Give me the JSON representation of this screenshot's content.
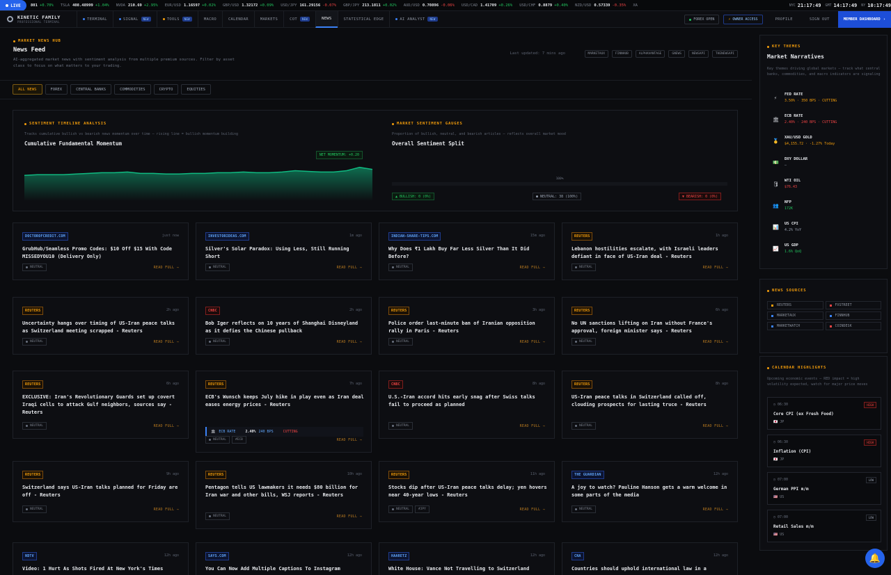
{
  "ticker": {
    "live_label": "LIVE",
    "items": [
      {
        "sym": "",
        "price": "801",
        "chg": "+0.70%",
        "dir": "up"
      },
      {
        "sym": "TSLA",
        "price": "408.48999",
        "chg": "+1.04%",
        "dir": "up"
      },
      {
        "sym": "NVDA",
        "price": "210.69",
        "chg": "+2.95%",
        "dir": "up"
      },
      {
        "sym": "EUR/USD",
        "price": "1.16597",
        "chg": "+0.02%",
        "dir": "up"
      },
      {
        "sym": "GBP/USD",
        "price": "1.32172",
        "chg": "+0.09%",
        "dir": "up"
      },
      {
        "sym": "USD/JPY",
        "price": "161.29156",
        "chg": "-0.07%",
        "dir": "dn"
      },
      {
        "sym": "GBP/JPY",
        "price": "213.1811",
        "chg": "+0.02%",
        "dir": "up"
      },
      {
        "sym": "AUD/USD",
        "price": "0.70896",
        "chg": "-0.06%",
        "dir": "dn"
      },
      {
        "sym": "USD/CAD",
        "price": "1.41709",
        "chg": "+0.26%",
        "dir": "up"
      },
      {
        "sym": "USD/CHF",
        "price": "0.8879",
        "chg": "+0.40%",
        "dir": "up"
      },
      {
        "sym": "NZD/USD",
        "price": "0.57339",
        "chg": "-0.35%",
        "dir": "dn"
      },
      {
        "sym": "XA",
        "price": "",
        "chg": "",
        "dir": "up"
      }
    ],
    "clocks": [
      {
        "city": "NYC",
        "time": "21:17:49"
      },
      {
        "city": "GMT",
        "time": "14:17:49"
      },
      {
        "city": "NY",
        "time": "10:17:49"
      }
    ]
  },
  "nav": {
    "brand_title": "KINETIC FAMILY",
    "brand_sub": "PROFESSIONAL TERMINAL",
    "items": [
      {
        "label": "TERMINAL",
        "dot": "#3b82f6",
        "badge": ""
      },
      {
        "label": "SIGNAL",
        "dot": "#3b82f6",
        "badge": "NEW"
      },
      {
        "label": "TOOLS",
        "dot": "#f59e0b",
        "badge": "NEW"
      },
      {
        "label": "MACRO",
        "dot": "",
        "badge": ""
      },
      {
        "label": "CALENDAR",
        "dot": "",
        "badge": ""
      },
      {
        "label": "MARKETS",
        "dot": "",
        "badge": ""
      },
      {
        "label": "COT",
        "dot": "",
        "badge": "NEW"
      },
      {
        "label": "NEWS",
        "dot": "",
        "badge": ""
      },
      {
        "label": "STATISTICAL EDGE",
        "dot": "",
        "badge": ""
      },
      {
        "label": "AI ANALYST",
        "dot": "#3b82f6",
        "badge": "NEW"
      }
    ],
    "forex_open": "FOREX OPEN",
    "owner_access": "OWNER ACCESS",
    "profile": "PROFILE",
    "sign_out": "SIGN OUT",
    "member": "MEMBER DASHBOARD"
  },
  "hero": {
    "eyebrow": "MARKET NEWS HUB",
    "title": "News Feed",
    "subtitle": "AI-aggregated market news with sentiment analysis from multiple premium sources. Filter by asset class to focus on what matters to your trading.",
    "updated": "Last updated: 7 mins ago",
    "sources": [
      "MARKETAUX",
      "FINNHUB",
      "ALPHAVANTAGE",
      "GNEWS",
      "NEWSAPI",
      "THENEWSAPI"
    ]
  },
  "filters": [
    "ALL NEWS",
    "FOREX",
    "CENTRAL BANKS",
    "COMMODITIES",
    "CRYPTO",
    "EQUITIES"
  ],
  "timeline": {
    "eyebrow": "SENTIMENT TIMELINE ANALYSIS",
    "subtitle": "Tracks cumulative bullish vs bearish news momentum over time — rising line = bullish momentum building",
    "title": "Cumulative Fundamental Momentum",
    "net_momentum": "NET MOMENTUM: +0.20"
  },
  "gauges": {
    "eyebrow": "MARKET SENTIMENT GAUGES",
    "subtitle": "Proportion of bullish, neutral, and bearish articles — reflects overall market mood",
    "title": "Overall Sentiment Split",
    "pct_label": "100%",
    "bullish": "▲ BULLISH: 0 (0%)",
    "neutral": "● NEUTRAL: 38 (100%)",
    "bearish": "▼ BEARISH: 0 (0%)"
  },
  "chart_data": {
    "type": "area",
    "title": "Cumulative Fundamental Momentum",
    "y": [
      0.08,
      0.09,
      0.09,
      0.09,
      0.1,
      0.11,
      0.12,
      0.12,
      0.13,
      0.11,
      0.11,
      0.1,
      0.1,
      0.11,
      0.11,
      0.12,
      0.12,
      0.13,
      0.12,
      0.12,
      0.13,
      0.15,
      0.14,
      0.13,
      0.13,
      0.15,
      0.2,
      0.17
    ],
    "ylim": [
      -0.3,
      0.3
    ],
    "grid": false
  },
  "cards": [
    {
      "src": "DOCTOROFCREDIT.COM",
      "kind": "blue",
      "ago": "just now",
      "title": "GrubHub/Seamless Promo Codes: $10 Off $15 With Code MISSEDYOU10 (Delivery Only)",
      "tags": [
        "NEUTRAL"
      ],
      "read": "READ FULL →"
    },
    {
      "src": "INVESTORIDEAS.COM",
      "kind": "blue",
      "ago": "1m ago",
      "title": "Silver's Solar Paradox: Using Less, Still Running Short",
      "tags": [
        "NEUTRAL"
      ],
      "read": "READ FULL →"
    },
    {
      "src": "INDIAN-SHARE-TIPS.COM",
      "kind": "blue",
      "ago": "15m ago",
      "title": "Why Does ₹1 Lakh Buy Far Less Silver Than It Did Before?",
      "tags": [
        "NEUTRAL"
      ],
      "read": "READ FULL →"
    },
    {
      "src": "REUTERS",
      "kind": "orange",
      "ago": "1h ago",
      "title": "Lebanon hostilities escalate, with Israeli leaders defiant in face of US-Iran deal - Reuters",
      "tags": [
        "NEUTRAL"
      ],
      "read": "READ FULL →"
    },
    {
      "src": "REUTERS",
      "kind": "orange",
      "ago": "2h ago",
      "title": "Uncertainty hangs over timing of US-Iran peace talks as Switzerland meeting scrapped - Reuters",
      "tags": [
        "NEUTRAL"
      ],
      "read": "READ FULL →"
    },
    {
      "src": "CNBC",
      "kind": "red",
      "ago": "2h ago",
      "title": "Bob Iger reflects on 10 years of Shanghai Disneyland as it defies the Chinese pullback",
      "tags": [
        "NEUTRAL"
      ],
      "read": "READ FULL →"
    },
    {
      "src": "REUTERS",
      "kind": "orange",
      "ago": "3h ago",
      "title": "Police order last-minute ban of Iranian opposition rally in Paris - Reuters",
      "tags": [
        "NEUTRAL"
      ],
      "read": "READ FULL →"
    },
    {
      "src": "REUTERS",
      "kind": "orange",
      "ago": "6h ago",
      "title": "No UN sanctions lifting on Iran without France's approval, foreign minister says - Reuters",
      "tags": [
        "NEUTRAL"
      ],
      "read": "READ FULL →"
    },
    {
      "src": "REUTERS",
      "kind": "orange",
      "ago": "6h ago",
      "title": "EXCLUSIVE: Iran's Revolutionary Guards set up covert Iraqi cells to attack Gulf neighbors, sources say - Reuters",
      "tags": [
        "NEUTRAL"
      ],
      "read": "READ FULL →"
    },
    {
      "src": "REUTERS",
      "kind": "orange",
      "ago": "7h ago",
      "title": "ECB's Wunsch keeps July hike in play even as Iran deal eases energy prices - Reuters",
      "tags": [
        "NEUTRAL",
        "#ECB"
      ],
      "read": "READ FULL →",
      "rate": {
        "icon": "🏛",
        "name": "ECB RATE",
        "val": "2.40%",
        "bps": "240 BPS",
        "state": "CUTTING"
      }
    },
    {
      "src": "CNBC",
      "kind": "red",
      "ago": "8h ago",
      "title": "U.S.-Iran accord hits early snag after Swiss talks fail to proceed as planned",
      "tags": [
        "NEUTRAL"
      ],
      "read": "READ FULL →"
    },
    {
      "src": "REUTERS",
      "kind": "orange",
      "ago": "8h ago",
      "title": "US-Iran peace talks in Switzerland called off, clouding prospects for lasting truce - Reuters",
      "tags": [
        "NEUTRAL"
      ],
      "read": "READ FULL →"
    },
    {
      "src": "REUTERS",
      "kind": "orange",
      "ago": "9h ago",
      "title": "Switzerland says US-Iran talks planned for Friday are off - Reuters",
      "tags": [
        "NEUTRAL"
      ],
      "read": "READ FULL →"
    },
    {
      "src": "REUTERS",
      "kind": "orange",
      "ago": "10h ago",
      "title": "Pentagon tells US lawmakers it needs $80 billion for Iran war and other bills, WSJ reports - Reuters",
      "tags": [
        "NEUTRAL"
      ],
      "read": "READ FULL →"
    },
    {
      "src": "REUTERS",
      "kind": "orange",
      "ago": "11h ago",
      "title": "Stocks dip after US-Iran peace talks delay; yen hovers near 40-year lows - Reuters",
      "tags": [
        "NEUTRAL",
        "#JPY"
      ],
      "read": "READ FULL →"
    },
    {
      "src": "THE GUARDIAN",
      "kind": "blue",
      "ago": "12h ago",
      "title": "A joy to watch? Pauline Hanson gets a warm welcome in some parts of the media",
      "tags": [
        "NEUTRAL"
      ],
      "read": "READ FULL →"
    },
    {
      "src": "NDTV",
      "kind": "blue",
      "ago": "12h ago",
      "title": "Video: 1 Hurt As Shots Fired At New York's Times",
      "tags": [],
      "read": ""
    },
    {
      "src": "SAYS.COM",
      "kind": "blue",
      "ago": "12h ago",
      "title": "You Can Now Add Multiple Captions To Instagram",
      "tags": [],
      "read": ""
    },
    {
      "src": "HAARETZ",
      "kind": "blue",
      "ago": "12h ago",
      "title": "White House: Vance Not Travelling to Switzerland",
      "tags": [],
      "read": ""
    },
    {
      "src": "CNA",
      "kind": "blue",
      "ago": "12h ago",
      "title": "Countries should uphold international law in a",
      "tags": [],
      "read": ""
    }
  ],
  "themes": {
    "eyebrow": "KEY THEMES",
    "title": "Market Narratives",
    "subtitle": "Key themes driving global markets — track what central banks, commodities, and macro indicators are signaling",
    "items": [
      {
        "icon": "⚡",
        "name": "FED RATE",
        "val": "3.50% · 350 BPS · CUTTING",
        "color": "#f59e0b"
      },
      {
        "icon": "🏛",
        "name": "ECB RATE",
        "val": "2.40% · 240 BPS · CUTTING",
        "color": "#ef4444"
      },
      {
        "icon": "🥇",
        "name": "XAU/USD GOLD",
        "val": "$4,155.72 · -1.27% Today",
        "color": "#f59e0b"
      },
      {
        "icon": "💵",
        "name": "DXY DOLLAR",
        "val": "—",
        "color": "#9aa3b2"
      },
      {
        "icon": "🛢",
        "name": "WTI OIL",
        "val": "$76.43",
        "color": "#ef4444"
      },
      {
        "icon": "👥",
        "name": "NFP",
        "val": "172K",
        "color": "#22c55e"
      },
      {
        "icon": "📊",
        "name": "US CPI",
        "val": "4.2% YoY",
        "color": "#9aa3b2"
      },
      {
        "icon": "📈",
        "name": "US GDP",
        "val": "1.6% QoQ",
        "color": "#22c55e"
      }
    ]
  },
  "news_sources": {
    "eyebrow": "NEWS SOURCES",
    "items": [
      {
        "name": "REUTERS",
        "color": "#f59e0b"
      },
      {
        "name": "FXSTREET",
        "color": "#ef4444"
      },
      {
        "name": "MARKETAUX",
        "color": "#3b82f6"
      },
      {
        "name": "FINNHUB",
        "color": "#3b82f6"
      },
      {
        "name": "MARKETWATCH",
        "color": "#3b82f6"
      },
      {
        "name": "COINDESK",
        "color": "#ef4444"
      }
    ]
  },
  "calendar": {
    "eyebrow": "CALENDAR HIGHLIGHTS",
    "subtitle": "Upcoming economic events — RED impact = high volatility expected, watch for major price moves",
    "items": [
      {
        "time": "◷ 06:30",
        "impact": "HIGH",
        "name": "Core CPI (ex Fresh Food)",
        "country": "🇯🇵 JP"
      },
      {
        "time": "◷ 06:30",
        "impact": "HIGH",
        "name": "Inflation (CPI)",
        "country": "🇯🇵 JP"
      },
      {
        "time": "◷ 07:00",
        "impact": "LOW",
        "name": "German PPI m/m",
        "country": "🇺🇸 US"
      },
      {
        "time": "◷ 07:00",
        "impact": "LOW",
        "name": "Retail Sales m/m",
        "country": "🇺🇸 US"
      }
    ]
  },
  "colors": {
    "accent": "#f59e0b",
    "primary": "#2563eb",
    "bull": "#22c55e",
    "bear": "#ef4444"
  }
}
